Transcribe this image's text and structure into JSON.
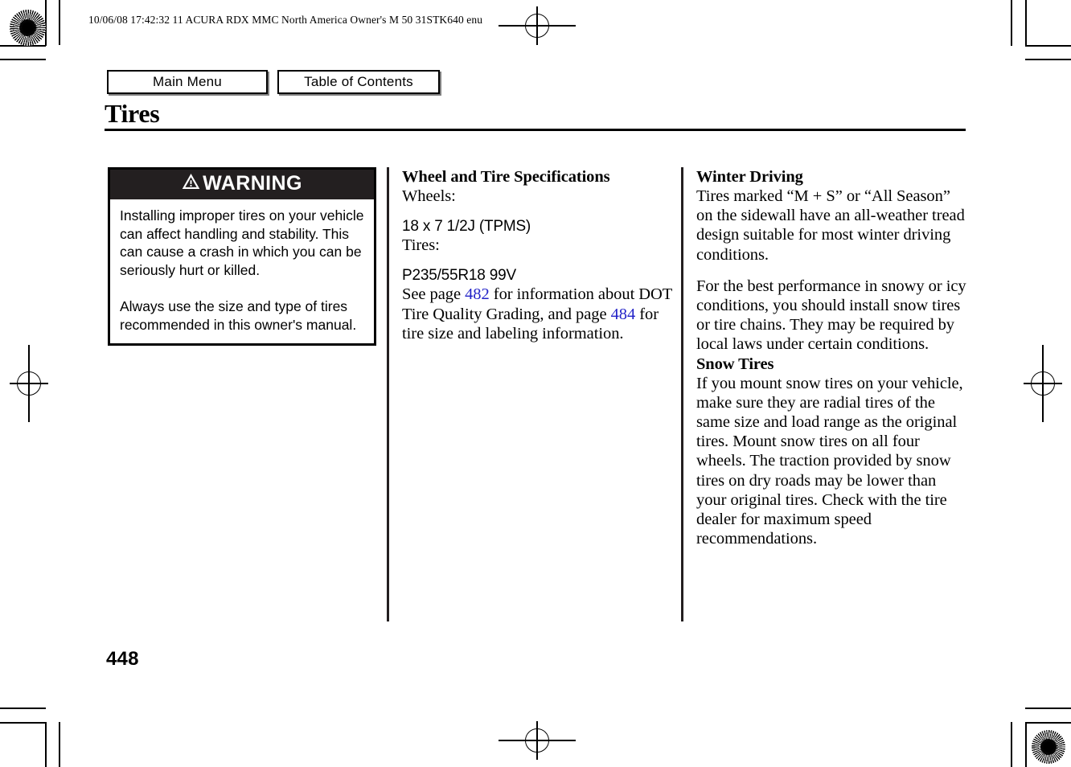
{
  "document": {
    "slug_line": "10/06/08 17:42:32   11 ACURA RDX MMC North America Owner's M 50 31STK640 enu",
    "page_title": "Tires",
    "page_number": "448"
  },
  "nav": {
    "main_menu_label": "Main Menu",
    "table_of_contents_label": "Table of Contents"
  },
  "warning": {
    "header_label": "WARNING",
    "icon": "warning-triangle-icon",
    "paragraph_1": "Installing improper tires on your vehicle can affect handling and stability. This can cause a crash in which you can be seriously hurt or killed.",
    "paragraph_2": "Always use the size and type of tires recommended in this owner's manual."
  },
  "specs": {
    "heading": "Wheel and Tire Specifications",
    "wheels_label": "Wheels:",
    "wheels_value": "18 x 7 1/2J (TPMS)",
    "tires_label": "Tires:",
    "tires_value": "P235/55R18 99V",
    "reference_prefix": "See page ",
    "reference_page_1": "482",
    "reference_middle": " for information about DOT Tire Quality Grading, and page ",
    "reference_page_2": "484",
    "reference_suffix": " for tire size and labeling information.",
    "xref_color": "#2323c8"
  },
  "winter": {
    "heading": "Winter Driving",
    "paragraph_1": "Tires marked “M + S” or “All Season” on the sidewall have an all-weather tread design suitable for most winter driving conditions.",
    "paragraph_2": "For the best performance in snowy or icy conditions, you should install snow tires or tire chains. They may be required by local laws under certain conditions."
  },
  "snow": {
    "heading": "Snow Tires",
    "paragraph_1": "If you mount snow tires on your vehicle, make sure they are radial tires of the same size and load range as the original tires. Mount snow tires on all four wheels. The traction provided by snow tires on dry roads may be lower than your original tires. Check with the tire dealer for maximum speed recommendations."
  },
  "print_marks": {
    "rosette_top_left": "registration-rosette",
    "rosette_bottom_right": "registration-rosette",
    "crosshair_top": "registration-crosshair",
    "crosshair_bottom": "registration-crosshair",
    "crosshair_left": "registration-crosshair",
    "crosshair_right": "registration-crosshair"
  }
}
